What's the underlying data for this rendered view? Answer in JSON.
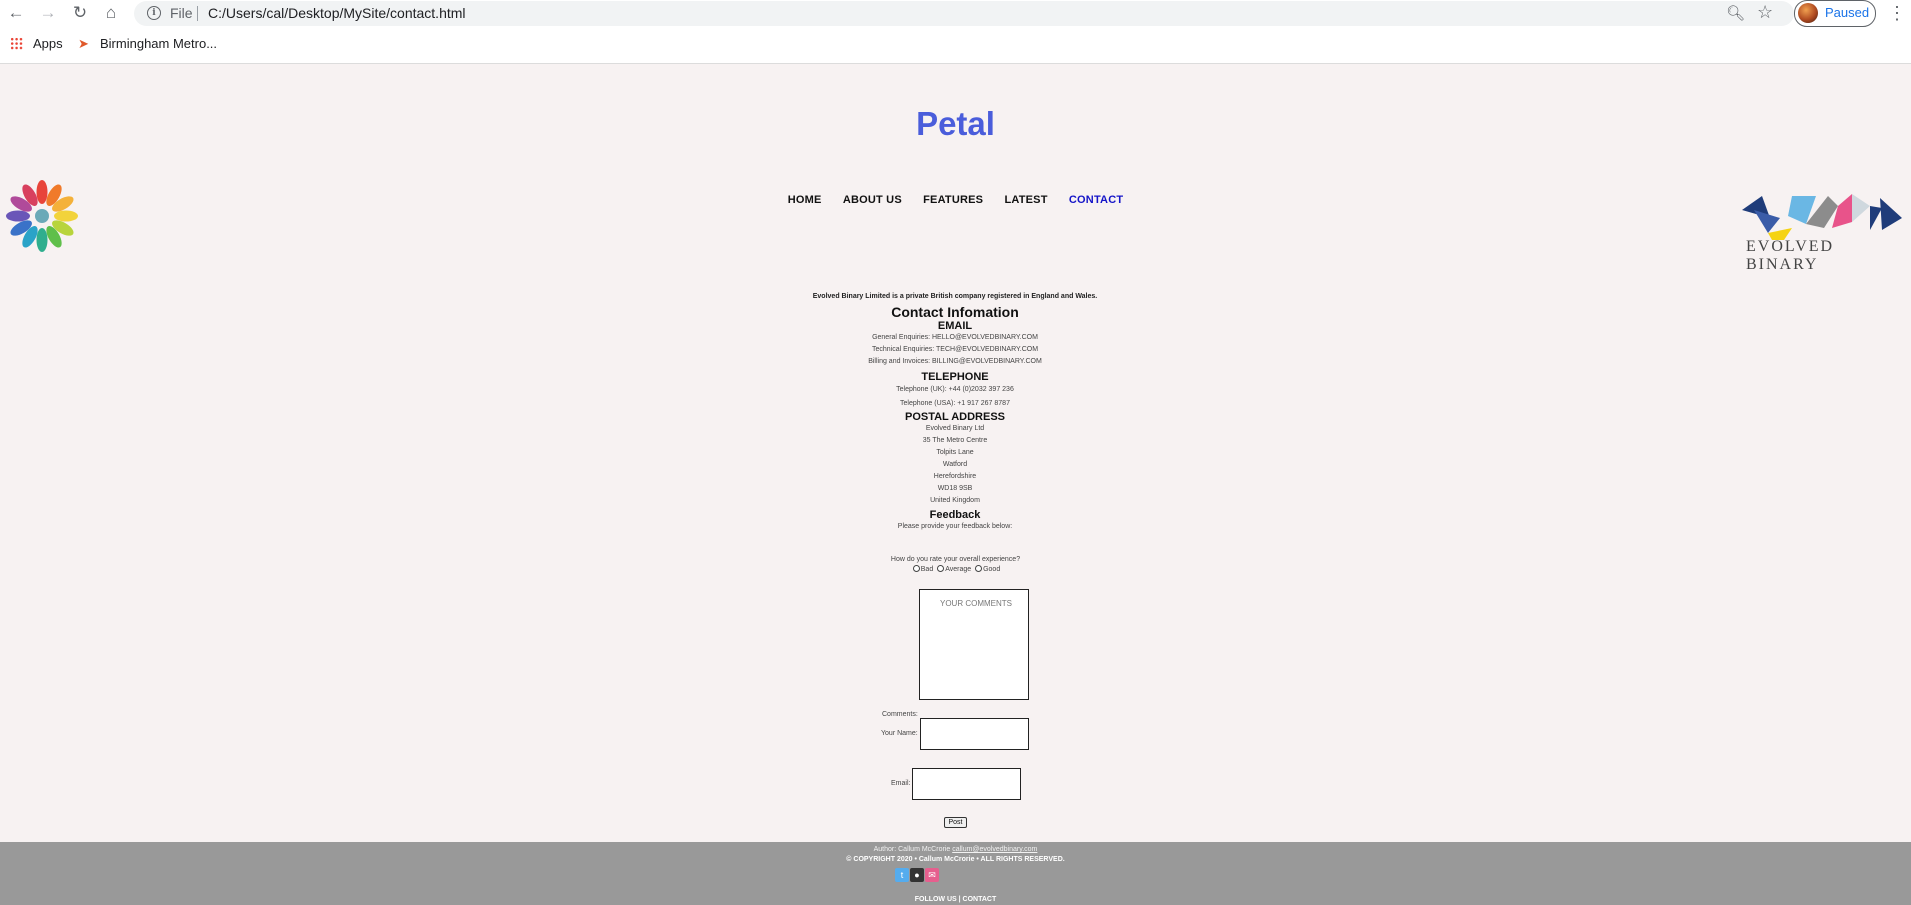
{
  "browser": {
    "url_scheme": "File",
    "url": "C:/Users/cal/Desktop/MySite/contact.html",
    "profile_label": "Paused",
    "bookmarks": [
      {
        "label": "Apps",
        "icon": "apps-grid-icon"
      },
      {
        "label": "Birmingham Metro...",
        "icon": "location-arrow-icon"
      }
    ]
  },
  "site": {
    "title": "Petal",
    "logo_text": "EVOLVED BINARY",
    "accent_color": "#4a5ddb"
  },
  "nav": {
    "items": [
      "HOME",
      "ABOUT US",
      "FEATURES",
      "LATEST",
      "CONTACT"
    ],
    "active": "CONTACT"
  },
  "contact": {
    "legal_note": "Evolved Binary Limited is a private British company registered in England and Wales.",
    "heading": "Contact Infomation",
    "email_heading": "EMAIL",
    "emails": [
      "General Enquiries: HELLO@EVOLVEDBINARY.COM",
      "Technical Enquiries: TECH@EVOLVEDBINARY.COM",
      "Billing and Invoices: BILLING@EVOLVEDBINARY.COM"
    ],
    "telephone_heading": "TELEPHONE",
    "phones": [
      "Telephone (UK): +44 (0)2032 397 236",
      "Telephone (USA): +1 917 267 8787"
    ],
    "postal_heading": "POSTAL ADDRESS",
    "address": [
      "Evolved Binary Ltd",
      "35 The Metro Centre",
      "Tolpits Lane",
      "Watford",
      "Herefordshire",
      "WD18 9SB",
      "United Kingdom"
    ]
  },
  "feedback": {
    "heading": "Feedback",
    "prompt": "Please provide your feedback below:",
    "rating_question": "How do you rate your overall experience?",
    "rating_options": [
      "Bad",
      "Average",
      "Good"
    ],
    "comments_placeholder": "YOUR COMMENTS",
    "comments_label": "Comments:",
    "name_label": "Your Name:",
    "email_label": "Email:",
    "submit_label": "Post"
  },
  "footer": {
    "author_prefix": "Author: Callum McCrorie",
    "author_email": "callum@evolvedbinary.com",
    "copyright": "© COPYRIGHT 2020 • Callum McCrorie • ALL RIGHTS RESERVED.",
    "social_icons": [
      "twitter-icon",
      "github-icon",
      "mail-icon"
    ],
    "follow": "FOLLOW US | CONTACT",
    "background": "#999999"
  }
}
